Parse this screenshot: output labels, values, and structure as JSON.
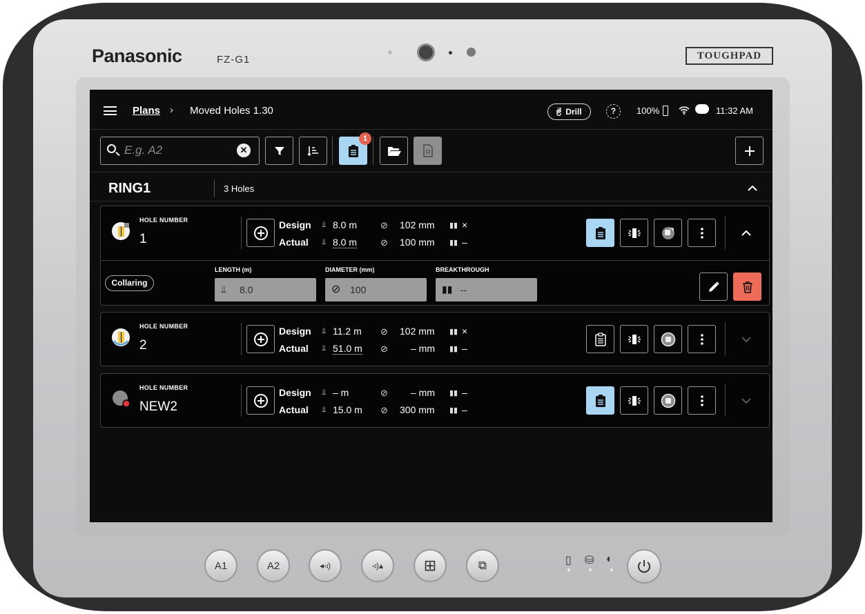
{
  "device": {
    "brand": "Panasonic",
    "model": "FZ-G1",
    "series": "TOUGHPAD",
    "hardware_buttons": [
      "A1",
      "A2",
      "◂◃)",
      "◃)▴",
      "⊞",
      "⧉"
    ]
  },
  "topbar": {
    "breadcrumb_root": "Plans",
    "breadcrumb_sep": "›",
    "breadcrumb_current": "Moved Holes 1.30",
    "mode_chip": "Drill",
    "help": "?",
    "battery": "100%",
    "time": "11:32 AM"
  },
  "toolbar": {
    "search_placeholder": "E.g. A2",
    "notification_count": "1"
  },
  "ring": {
    "name": "RING1",
    "count": "3 Holes"
  },
  "labels": {
    "hole_number": "HOLE NUMBER",
    "design": "Design",
    "actual": "Actual",
    "length": "LENGTH (m)",
    "diameter": "DIAMETER (mm)",
    "breakthrough": "BREAKTHROUGH",
    "collaring": "Collaring"
  },
  "holes": [
    {
      "number": "1",
      "design_length": "8.0 m",
      "design_diameter": "102 mm",
      "design_break": "×",
      "actual_length": "8.0 m",
      "actual_diameter": "100 mm",
      "actual_break": "–",
      "status_color": "#f2c73a"
    },
    {
      "number": "2",
      "design_length": "11.2 m",
      "design_diameter": "102 mm",
      "design_break": "×",
      "actual_length": "51.0 m",
      "actual_diameter": "– mm",
      "actual_break": "–",
      "status_color": "#f2c73a"
    },
    {
      "number": "NEW2",
      "design_length": "– m",
      "design_diameter": "– mm",
      "design_break": "–",
      "actual_length": "15.0 m",
      "actual_diameter": "300 mm",
      "actual_break": "–",
      "status_color": "#e0343f"
    }
  ],
  "expanded": {
    "length_value": "8.0",
    "diameter_value": "100",
    "breakthrough_value": "--"
  },
  "colors": {
    "accent": "#a9d6f2",
    "danger": "#ee6b58",
    "badge": "#e3614f"
  }
}
